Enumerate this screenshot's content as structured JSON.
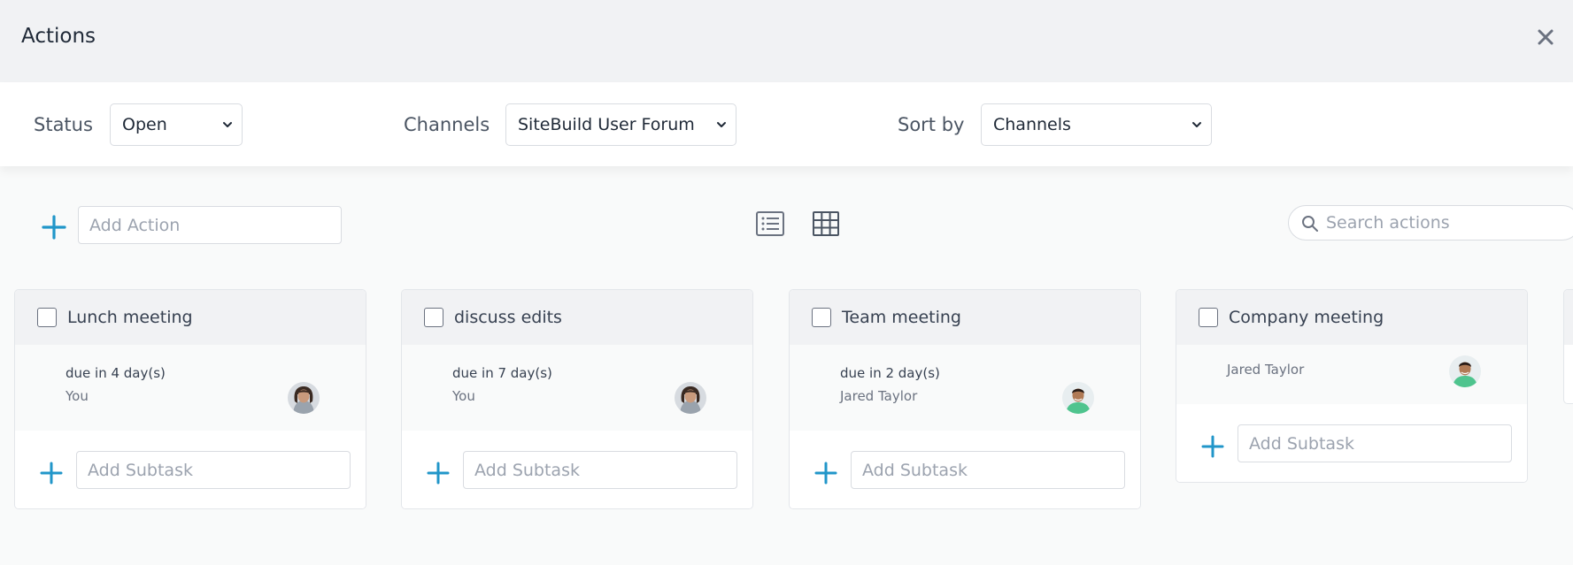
{
  "header": {
    "title": "Actions"
  },
  "filters": {
    "status": {
      "label": "Status",
      "value": "Open"
    },
    "channels": {
      "label": "Channels",
      "value": "SiteBuild User Forum"
    },
    "sort": {
      "label": "Sort by",
      "value": "Channels"
    }
  },
  "toolbar": {
    "add_action_placeholder": "Add Action",
    "search_placeholder": "Search actions"
  },
  "cards": [
    {
      "title": "Lunch meeting",
      "due": "due in 4 day(s)",
      "assignee": "You",
      "subtask_placeholder": "Add Subtask"
    },
    {
      "title": "discuss edits",
      "due": "due in 7 day(s)",
      "assignee": "You",
      "subtask_placeholder": "Add Subtask"
    },
    {
      "title": "Team meeting",
      "due": "due in 2 day(s)",
      "assignee": "Jared Taylor",
      "subtask_placeholder": "Add Subtask"
    },
    {
      "title": "Company meeting",
      "assignee": "Jared Taylor",
      "subtask_placeholder": "Add Subtask"
    }
  ],
  "colors": {
    "accent": "#2196c9",
    "header_bg": "#f1f2f4",
    "border": "#d9dce1"
  },
  "icons": {
    "close": "close-icon",
    "add": "plus-icon",
    "list_view": "list-view-icon",
    "grid_view": "grid-view-icon",
    "search": "search-icon",
    "dropdown": "chevron-down-icon"
  }
}
